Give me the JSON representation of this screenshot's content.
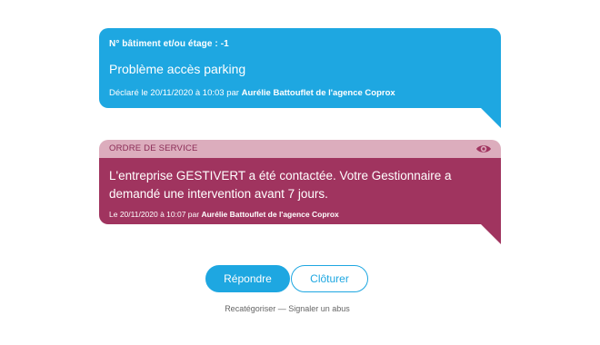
{
  "declaration": {
    "location": "N° bâtiment et/ou étage : -1",
    "title": "Problème accès parking",
    "declared_prefix": "Déclaré le 20/11/2020 à 10:03 par ",
    "declared_author": "Aurélie Battouflet de l'agence Coprox",
    "color": "#1ea7e1"
  },
  "service_order": {
    "header": "ORDRE DE SERVICE",
    "view_icon": "eye-icon",
    "message": "L'entreprise GESTIVERT a été contactée. Votre Gestionnaire a demandé une intervention avant 7 jours.",
    "signed_prefix": "Le 20/11/2020 à 10:07 par ",
    "signed_author": "Aurélie Battouflet de l'agence Coprox",
    "color": "#a0345f",
    "header_color": "#dcadbd"
  },
  "actions": {
    "reply_label": "Répondre",
    "close_label": "Clôturer"
  },
  "footer": {
    "recategorize_label": "Recatégoriser",
    "separator": " — ",
    "report_label": "Signaler un abus"
  }
}
